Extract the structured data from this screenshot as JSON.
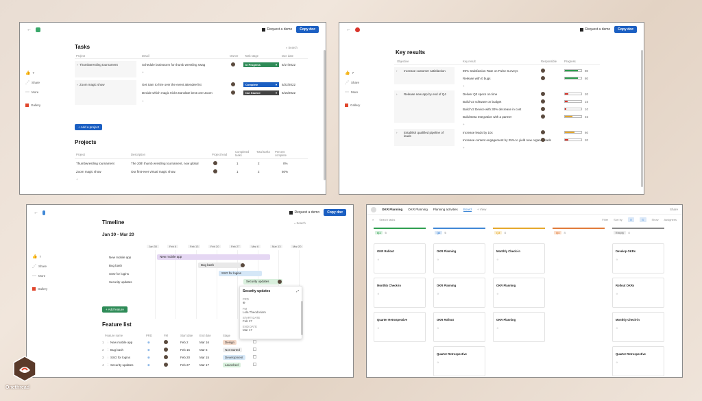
{
  "common": {
    "request_demo": "Request a demo",
    "copy_doc": "Copy doc",
    "side_share": "Share",
    "side_more": "More",
    "side_gallery": "Gallery",
    "side_like": "7"
  },
  "tasks": {
    "title": "Tasks",
    "search": "Search",
    "columns": [
      "Project",
      "Detail",
      "Owner",
      "Task stage",
      "Due date"
    ],
    "rows": [
      {
        "project": "Thumbwrestling tournament",
        "detail": "Schedule brainstorm for thumb wrestling swag",
        "stage": "In Progress",
        "stage_color": "#2e8b57",
        "due": "5/17/2022"
      },
      {
        "project": "Zoom magic show",
        "detail": "Get Sam to hire over the event attendee list",
        "stage": "Complete",
        "stage_color": "#1b5fc2",
        "due": "5/22/2022"
      },
      {
        "project": "",
        "detail": "Decide which magic tricks translate best over Zoom",
        "stage": "Not Started",
        "stage_color": "#444444",
        "due": "6/16/2022"
      }
    ],
    "add_project": "Add a project",
    "projects_title": "Projects",
    "proj_columns": [
      "Project",
      "Description",
      "Project lead",
      "Completed tasks",
      "Total tasks",
      "Percent complete"
    ],
    "proj_rows": [
      {
        "name": "Thumbwrestling tournament",
        "desc": "The 20th thumb wrestling tournament, now global",
        "done": "1",
        "total": "2",
        "pct": "0%"
      },
      {
        "name": "Zoom magic show",
        "desc": "Our first-ever virtual magic show.",
        "done": "1",
        "total": "2",
        "pct": "50%"
      }
    ]
  },
  "kr": {
    "title": "Key results",
    "columns": [
      "Objective",
      "Key result",
      "Responsible",
      "Progress"
    ],
    "objectives": [
      {
        "name": "Increase customer satisfaction",
        "results": [
          {
            "text": "99% Satisfaction Rate on Pulse Surveys",
            "pct": 80,
            "color": "#2e9e4f",
            "val": "80"
          },
          {
            "text": "Release with 0 bugs",
            "pct": 80,
            "color": "#2e9e4f",
            "val": "80"
          }
        ]
      },
      {
        "name": "Release new app by end of Q4",
        "results": [
          {
            "text": "Deliver Q3 specs on time",
            "pct": 20,
            "color": "#d9342b",
            "val": "20"
          },
          {
            "text": "Build V2 software on budget",
            "pct": 15,
            "color": "#d9342b",
            "val": "15"
          },
          {
            "text": "Build V2 Device with 30% decrease in cost",
            "pct": 10,
            "color": "#d9342b",
            "val": "10"
          },
          {
            "text": "Build Beta Integration with a partner",
            "pct": 45,
            "color": "#e6a82b",
            "val": "45"
          }
        ]
      },
      {
        "name": "Establish qualified pipeline of leads",
        "results": [
          {
            "text": "Increase leads by 10x",
            "pct": 60,
            "color": "#e6a82b",
            "val": "60"
          },
          {
            "text": "Increase content engagement by 25% to yield new organic leads",
            "pct": 20,
            "color": "#d9342b",
            "val": "20"
          }
        ]
      }
    ]
  },
  "timeline": {
    "title": "Timeline",
    "range": "Jan 30 - Mar 20",
    "search": "Search",
    "dates": [
      "Jan 30",
      "Feb 6",
      "Feb 13",
      "Feb 20",
      "Feb 27",
      "Mar 6",
      "Mar 13",
      "Mar 20"
    ],
    "items": [
      "New mobile app",
      "Bug bash",
      "SSO for logins",
      "Security updates"
    ],
    "bars": [
      {
        "label": "New mobile app",
        "start": 0.5,
        "end": 6.0,
        "color": "#e5d7f3"
      },
      {
        "label": "Bug bash",
        "start": 2.5,
        "end": 4.6,
        "color": "#e9e9e9"
      },
      {
        "label": "SSO for logins",
        "start": 3.5,
        "end": 5.6,
        "color": "#d5e7f7"
      },
      {
        "label": "Security updates",
        "start": 4.7,
        "end": 6.6,
        "color": "#d8efdc"
      }
    ],
    "popup": {
      "title": "Security updates",
      "pm_label": "PRD",
      "fm_label": "FM",
      "fm_name": "Lola Theodoriam",
      "start_label": "START DATE",
      "start": "Feb 27",
      "end_label": "END DATE",
      "end": "Mar 17"
    },
    "add_feature": "Add feature",
    "feature_title": "Feature list",
    "fcolumns": [
      "Feature name",
      "PRD",
      "FM",
      "Start date",
      "End date",
      "Stage"
    ],
    "frows": [
      {
        "n": "1",
        "name": "New mobile app",
        "start": "Feb 2",
        "end": "Mar 16",
        "stage": "Design",
        "sc": "#f3d9c9"
      },
      {
        "n": "2",
        "name": "Bug bash",
        "start": "Feb 15",
        "end": "Mar 5",
        "stage": "Not started",
        "sc": "#eeeeee"
      },
      {
        "n": "3",
        "name": "SSO for logins",
        "start": "Feb 20",
        "end": "Mar 15",
        "stage": "Development",
        "sc": "#d6e8f8"
      },
      {
        "n": "4",
        "name": "Security updates",
        "start": "Feb 27",
        "end": "Mar 17",
        "stage": "Launched",
        "sc": "#d8efdc"
      }
    ]
  },
  "okr": {
    "tabs": [
      "OKR Planning",
      "OKR Planning",
      "Planning activities",
      "Board",
      "View"
    ],
    "search": "Search tasks",
    "filters": [
      "Filter",
      "Sort by",
      "Show",
      "Assignees",
      "Share"
    ],
    "columns": [
      {
        "badge": "Q1",
        "count": "5",
        "color": "#2e9e4f",
        "bg": "#d8f0de"
      },
      {
        "badge": "Q2",
        "count": "5",
        "color": "#3f87d6",
        "bg": "#dce9f8"
      },
      {
        "badge": "Q3",
        "count": "4",
        "color": "#e6a82b",
        "bg": "#fbefd2"
      },
      {
        "badge": "Q4",
        "count": "4",
        "color": "#e07b39",
        "bg": "#fadfcc"
      },
      {
        "badge": "Empty",
        "count": "4",
        "color": "#888888",
        "bg": "#eeeeee"
      }
    ],
    "cards": [
      [
        "OKR Rollout",
        "Monthly Check-in",
        "Quarter Retrospective"
      ],
      [
        "OKR Planning",
        "OKR Planning",
        "OKR Rollout",
        "Quarter Retrospective"
      ],
      [
        "Monthly Check-in",
        "OKR Planning",
        "OKR Planning"
      ],
      [],
      [
        "Develop OKRs",
        "Rollout OKRs",
        "Monthly Check-in",
        "Quarter Retrospective"
      ]
    ]
  },
  "brand": {
    "name": "Onethread"
  }
}
